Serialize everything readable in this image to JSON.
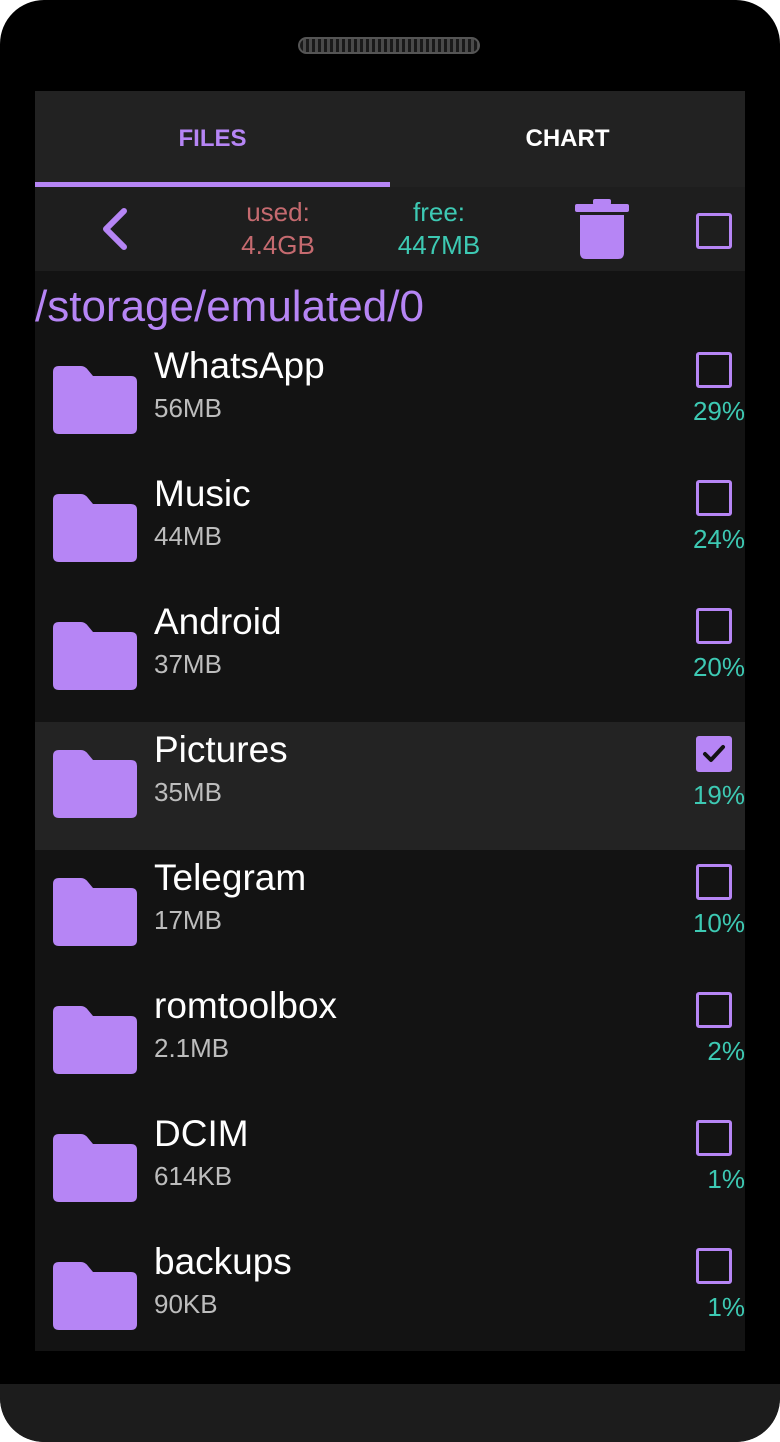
{
  "tabs": [
    {
      "label": "FILES",
      "active": true
    },
    {
      "label": "CHART",
      "active": false
    }
  ],
  "toolbar": {
    "back_icon": "chevron-left-icon",
    "used_label": "used:",
    "used_value": "4.4GB",
    "free_label": "free:",
    "free_value": "447MB",
    "delete_icon": "trash-icon",
    "select_all_checked": false
  },
  "path": "/storage/emulated/0",
  "colors": {
    "accent": "#b685f5",
    "used": "#c56a6f",
    "free": "#3dc9b3",
    "background": "#131313"
  },
  "items": [
    {
      "name": "WhatsApp",
      "size": "56MB",
      "percent": "29%",
      "checked": false,
      "icon": "folder-icon"
    },
    {
      "name": "Music",
      "size": "44MB",
      "percent": "24%",
      "checked": false,
      "icon": "folder-icon"
    },
    {
      "name": "Android",
      "size": "37MB",
      "percent": "20%",
      "checked": false,
      "icon": "folder-icon"
    },
    {
      "name": "Pictures",
      "size": "35MB",
      "percent": "19%",
      "checked": true,
      "icon": "folder-icon"
    },
    {
      "name": "Telegram",
      "size": "17MB",
      "percent": "10%",
      "checked": false,
      "icon": "folder-icon"
    },
    {
      "name": "romtoolbox",
      "size": "2.1MB",
      "percent": "2%",
      "checked": false,
      "icon": "folder-icon"
    },
    {
      "name": "DCIM",
      "size": "614KB",
      "percent": "1%",
      "checked": false,
      "icon": "folder-icon"
    },
    {
      "name": "backups",
      "size": "90KB",
      "percent": "1%",
      "checked": false,
      "icon": "folder-icon"
    }
  ]
}
